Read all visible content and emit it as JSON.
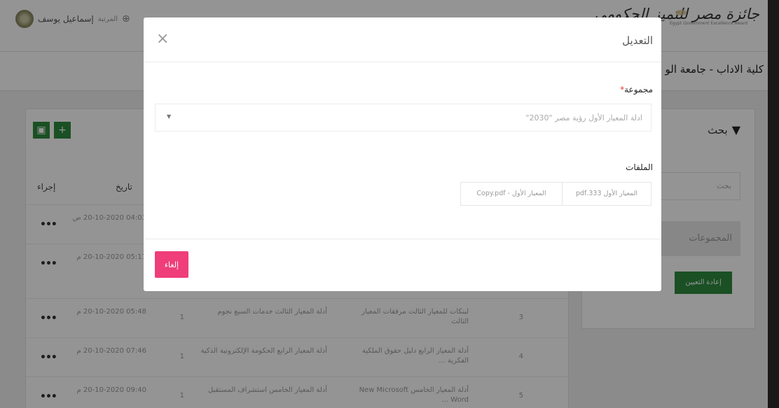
{
  "header": {
    "logo_text": "جائزة مصر للتميز الحكومي",
    "logo_subtext": "Egypt Government Excellence Award",
    "user_role": "المرتبة",
    "user_name": "إسماعيل يوسف",
    "page_title": "كلية الاداب - جامعة الو"
  },
  "filter": {
    "title": "بحث",
    "search_placeholder": "بحث",
    "groups_placeholder": "المجموعات",
    "reset_label": "إعادة التعيين"
  },
  "table": {
    "headers": {
      "action": "إجراء",
      "date": "تاريخ"
    },
    "rows": [
      {
        "num": "",
        "files": "",
        "name": "",
        "count": "",
        "date": "04:03 20-10-2020 ص"
      },
      {
        "num": "",
        "files": "",
        "name": "",
        "count": "",
        "date": "05:17 20-10-2020 م"
      },
      {
        "num": "3",
        "files": "لبنكات للمعيار الثالث مرفقات المعيار الثالث",
        "name": "أدلة المعيار الثالث خدمات السبع نجوم",
        "count": "1",
        "date": "05:48 20-10-2020 م"
      },
      {
        "num": "4",
        "files": "أدلة المعيار الرابع دليل حقوق الملكية الفكرية ...",
        "name": "أدلة المعيار الرابع الحكومة الإلكترونية الذكية",
        "count": "1",
        "date": "07:46 20-10-2020 م"
      },
      {
        "num": "5",
        "files": "أدلة المعيار الخامس New Microsoft Word ...",
        "name": "أدلة المعيار الخامس استشراف المستقبل",
        "count": "1",
        "date": "09:40 20-10-2020 م"
      }
    ]
  },
  "modal": {
    "title": "التعديل",
    "group_label": "مجموعة",
    "required_mark": "*",
    "group_value": "ادلة المعيار الأول رؤية مصر \"2030\"",
    "files_label": "الملفات",
    "files": [
      "المعيار الأول 333.pdf",
      "المعيار الأول - Copy.pdf"
    ],
    "cancel_label": "إلغاء",
    "close_symbol": "×"
  }
}
